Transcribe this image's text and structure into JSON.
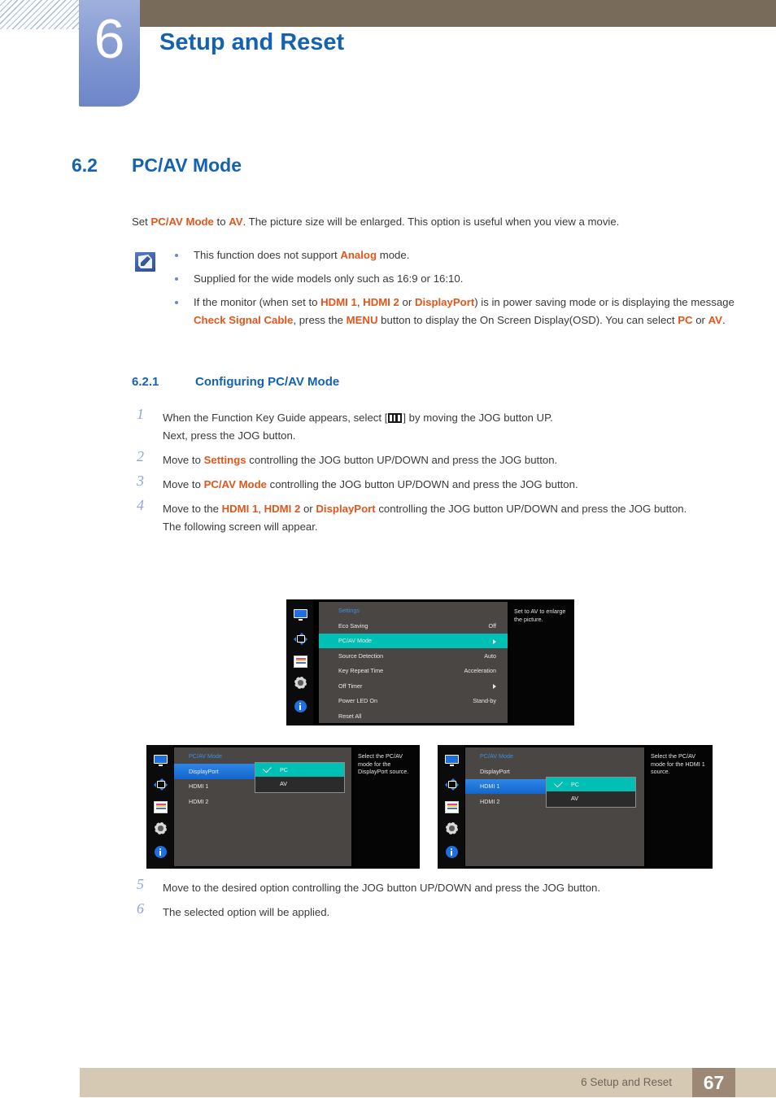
{
  "header": {
    "chapter_number": "6",
    "chapter_title": "Setup and Reset"
  },
  "section": {
    "number": "6.2",
    "title": "PC/AV Mode"
  },
  "intro": {
    "p1": "Set ",
    "k1": "PC/AV Mode",
    "p2": " to ",
    "k2": "AV",
    "p3": ". The picture size will be enlarged. This option is useful when you view a movie."
  },
  "note": {
    "icon": "note-pencil-icon",
    "bullets": [
      {
        "t1": "This function does not support ",
        "k1": "Analog",
        "t2": " mode."
      },
      {
        "t1": "Supplied for the wide models only such as 16:9 or 16:10.",
        "k1": "",
        "t2": ""
      },
      {
        "t1": "If the monitor (when set to ",
        "k1": "HDMI 1",
        "t2": ", ",
        "k2": "HDMI 2",
        "t3": " or ",
        "k3": "DisplayPort",
        "t4": ") is in power saving mode or is displaying the message ",
        "k4": "Check Signal Cable",
        "t5": ", press the ",
        "k5": "MENU",
        "t6": " button to display the On Screen Display(OSD). You can select ",
        "k6": "PC",
        "t7": " or ",
        "k7": "AV",
        "t8": "."
      }
    ]
  },
  "subsection": {
    "number": "6.2.1",
    "title": "Configuring PC/AV Mode"
  },
  "steps": [
    {
      "num": "1",
      "line1_a": "When the Function Key Guide appears, select [",
      "line1_icon": "jog-menu-icon",
      "line1_b": "] by moving the JOG button UP.",
      "line2": "Next, press the JOG button."
    },
    {
      "num": "2",
      "a": "Move to ",
      "k": "Settings",
      "b": " controlling the JOG button UP/DOWN and press the JOG button."
    },
    {
      "num": "3",
      "a": "Move to ",
      "k": "PC/AV Mode",
      "b": " controlling the JOG button UP/DOWN and press the JOG button."
    },
    {
      "num": "4",
      "a": "Move to the ",
      "k1": "HDMI 1",
      "b": ", ",
      "k2": "HDMI 2",
      "c": " or ",
      "k3": "DisplayPort",
      "d": " controlling the JOG button UP/DOWN and press the JOG button.",
      "line2": "The following screen will appear."
    }
  ],
  "steps_after": [
    {
      "num": "5",
      "text": "Move to the desired option controlling the JOG button UP/DOWN and press the JOG button."
    },
    {
      "num": "6",
      "text": "The selected option will be applied."
    }
  ],
  "osd_rail_icons": [
    "monitor-icon",
    "resize-icon",
    "color-bars-icon",
    "gear-icon",
    "info-icon"
  ],
  "osd_settings": {
    "menu_title": "Settings",
    "rows": [
      {
        "label": "Eco Saving",
        "value": "Off",
        "arrow": false,
        "state": "normal"
      },
      {
        "label": "PC/AV Mode",
        "value": "",
        "arrow": true,
        "state": "selected-teal"
      },
      {
        "label": "Source Detection",
        "value": "Auto",
        "arrow": false,
        "state": "normal"
      },
      {
        "label": "Key Repeat Time",
        "value": "Acceleration",
        "arrow": false,
        "state": "normal"
      },
      {
        "label": "Off Timer",
        "value": "",
        "arrow": true,
        "state": "normal"
      },
      {
        "label": "Power LED On",
        "value": "Stand-by",
        "arrow": false,
        "state": "normal"
      },
      {
        "label": "Reset All",
        "value": "",
        "arrow": false,
        "state": "normal"
      }
    ],
    "tip": "Set to AV to enlarge the picture."
  },
  "osd_dp": {
    "menu_title": "PC/AV Mode",
    "rows": [
      {
        "label": "DisplayPort",
        "state": "selected-blue"
      },
      {
        "label": "HDMI 1",
        "state": "normal"
      },
      {
        "label": "HDMI 2",
        "state": "normal"
      }
    ],
    "options": [
      {
        "label": "PC",
        "checked": true
      },
      {
        "label": "AV",
        "checked": false
      }
    ],
    "tip": "Select the PC/AV mode for the DisplayPort source."
  },
  "osd_hdmi1": {
    "menu_title": "PC/AV Mode",
    "rows": [
      {
        "label": "DisplayPort",
        "state": "normal"
      },
      {
        "label": "HDMI 1",
        "state": "selected-blue"
      },
      {
        "label": "HDMI 2",
        "state": "normal"
      }
    ],
    "options": [
      {
        "label": "PC",
        "checked": true
      },
      {
        "label": "AV",
        "checked": false
      }
    ],
    "tip": "Select the PC/AV mode for the HDMI 1 source."
  },
  "footer": {
    "text": "6 Setup and Reset",
    "page": "67"
  },
  "colors": {
    "heading_blue": "#1462b0",
    "keyword_orange": "#e2561d",
    "chapter_box": "#7f96d0",
    "header_brown": "#786b5a",
    "footer_band": "#d6c9b4",
    "page_box": "#9c8875",
    "osd_teal": "#00bfb4",
    "osd_blue": "#1f6fe0",
    "osd_panel": "#4a4644"
  }
}
